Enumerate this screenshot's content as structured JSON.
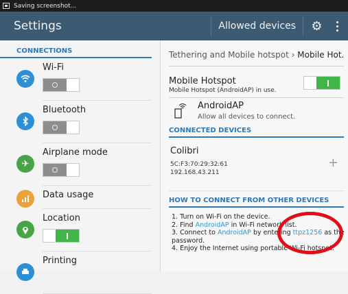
{
  "status_bar": {
    "text": "Saving screenshot..."
  },
  "action_bar": {
    "title": "Settings",
    "allowed_devices": "Allowed devices"
  },
  "connections": {
    "header": "CONNECTIONS",
    "items": [
      {
        "label": "Wi-Fi",
        "icon": "wifi-icon",
        "color": "#2d8fd5",
        "toggle": "off"
      },
      {
        "label": "Bluetooth",
        "icon": "bluetooth-icon",
        "color": "#2d8fd5",
        "toggle": "off"
      },
      {
        "label": "Airplane mode",
        "icon": "airplane-icon",
        "color": "#49a447",
        "toggle": "off"
      },
      {
        "label": "Data usage",
        "icon": "data-usage-icon",
        "color": "#e8a33a"
      },
      {
        "label": "Location",
        "icon": "location-icon",
        "color": "#49a447",
        "toggle": "on"
      },
      {
        "label": "Printing",
        "icon": "printing-icon",
        "color": "#2d8fd5"
      }
    ]
  },
  "breadcrumb": {
    "parent": "Tethering and Mobile hotspot",
    "separator": "›",
    "current": "Mobile Hot.."
  },
  "hotspot": {
    "title": "Mobile Hotspot",
    "status": "Mobile Hotspot (AndroidAP) in use.",
    "toggle": "on"
  },
  "ap": {
    "name": "AndroidAP",
    "desc": "Allow all devices to connect."
  },
  "connected_devices": {
    "header": "CONNECTED DEVICES",
    "device": {
      "name": "Colibri",
      "mac": "5C:F3:70:29:32:61",
      "ip": "192.168.43.211"
    }
  },
  "how_to": {
    "header": "HOW TO CONNECT FROM OTHER DEVICES",
    "step1": "1. Turn on Wi-Fi on the device.",
    "step2_a": "2. Find ",
    "step2_ap": "AndroidAP",
    "step2_b": " in Wi-Fi network list.",
    "step3_a": "3. Connect to ",
    "step3_ap": "AndroidAP",
    "step3_b": " by entering ",
    "step3_pw": "ttpz1256",
    "step3_c": " as the password.",
    "step4": "4. Enjoy the Internet using portable Wi-Fi hotspot."
  },
  "colors": {
    "accent": "#2f78b7",
    "action_bar": "#3d5a73",
    "toggle_on": "#3fb54a",
    "annotation": "#e00d1a"
  }
}
